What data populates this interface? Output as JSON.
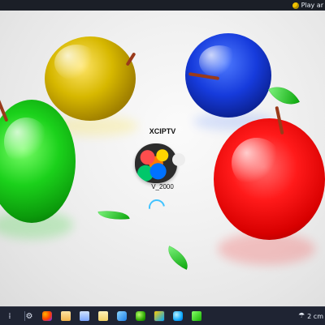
{
  "topbar": {
    "play_label": "Play ar"
  },
  "desktop": {
    "wallpaper_name": "glass-apples"
  },
  "app_overlay": {
    "title": "XCIPTV",
    "version": "V_2000"
  },
  "taskbar": {
    "items": [
      {
        "icon": "menu-icon"
      },
      {
        "icon": "gear-icon"
      },
      {
        "icon": "firefox-icon"
      },
      {
        "icon": "folder-icon"
      },
      {
        "icon": "documents-icon"
      },
      {
        "icon": "notes-icon"
      },
      {
        "icon": "swift-icon"
      },
      {
        "icon": "android-icon"
      },
      {
        "icon": "gaming-icon"
      },
      {
        "icon": "browser-icon"
      },
      {
        "icon": "app-icon"
      }
    ],
    "weather": "2 cm"
  },
  "colors": {
    "topbar_bg": "#1b1f27",
    "taskbar_bg": "#1f2433",
    "spinner": "#41c3ff"
  }
}
